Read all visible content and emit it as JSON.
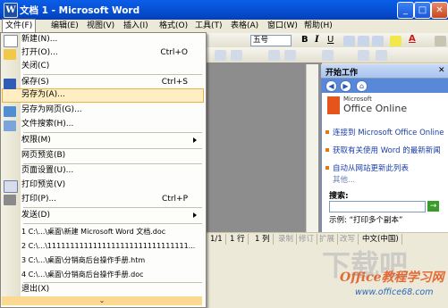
{
  "window": {
    "title": "文档 1 - Microsoft Word",
    "controls": {
      "minimize": "_",
      "maximize": "□",
      "close": "✕"
    },
    "app_icon": "W"
  },
  "menubar": {
    "items": [
      "文件(F)",
      "编辑(E)",
      "视图(V)",
      "插入(I)",
      "格式(O)",
      "工具(T)",
      "表格(A)",
      "窗口(W)",
      "帮助(H)"
    ]
  },
  "toolbar": {
    "font_size": "五号",
    "bold": "B",
    "italic": "I",
    "underline": "U",
    "font_color_letter": "A"
  },
  "file_menu": {
    "items": [
      {
        "label": "新建(N)...",
        "shortcut": "",
        "submenu": false
      },
      {
        "label": "打开(O)...",
        "shortcut": "Ctrl+O",
        "submenu": false
      },
      {
        "label": "关闭(C)",
        "shortcut": "",
        "submenu": false
      },
      {
        "label": "保存(S)",
        "shortcut": "Ctrl+S",
        "submenu": false
      },
      {
        "label": "另存为(A)...",
        "shortcut": "",
        "submenu": false,
        "highlighted": true
      },
      {
        "label": "另存为网页(G)...",
        "shortcut": "",
        "submenu": false
      },
      {
        "label": "文件搜索(H)...",
        "shortcut": "",
        "submenu": false
      },
      {
        "label": "权限(M)",
        "shortcut": "",
        "submenu": true
      },
      {
        "label": "网页预览(B)",
        "shortcut": "",
        "submenu": false
      },
      {
        "label": "页面设置(U)...",
        "shortcut": "",
        "submenu": false
      },
      {
        "label": "打印预览(V)",
        "shortcut": "",
        "submenu": false
      },
      {
        "label": "打印(P)...",
        "shortcut": "Ctrl+P",
        "submenu": false
      },
      {
        "label": "发送(D)",
        "shortcut": "",
        "submenu": true
      },
      {
        "label": "1 C:\\...\\桌面\\新建 Microsoft Word 文档.doc",
        "shortcut": "",
        "submenu": false
      },
      {
        "label": "2 C:\\...\\1111111111111111111111111111111...",
        "shortcut": "",
        "submenu": false
      },
      {
        "label": "3 C:\\...\\桌面\\分销商后台操作手册.htm",
        "shortcut": "",
        "submenu": false
      },
      {
        "label": "4 C:\\...\\桌面\\分销商后台操作手册.doc",
        "shortcut": "",
        "submenu": false
      },
      {
        "label": "退出(X)",
        "shortcut": "",
        "submenu": false
      }
    ],
    "more": "⌄"
  },
  "task_pane": {
    "title": "开始工作",
    "close": "✕",
    "logo_small": "Microsoft",
    "logo_large": "Office Online",
    "links": [
      "连接到 Microsoft Office Online",
      "获取有关使用 Word 的最新新闻",
      "自动从网站更新此列表"
    ],
    "more": "其他...",
    "search_label": "搜索:",
    "search_go": "→",
    "example": "示例: “打印多个副本”"
  },
  "statusbar": {
    "cells": [
      "1 行",
      "1 列",
      "录制",
      "修订",
      "扩展",
      "改写",
      "中文(中国)"
    ],
    "prefix": "1/1"
  },
  "watermark": {
    "main": "Office教程学习网",
    "url": "www.office68.com",
    "big": "下载吧"
  },
  "colors": {
    "title_bar": "#0852d8",
    "menu_highlight": "#ffeec2",
    "pane_header": "#a9c3ee"
  },
  "icons": [
    "new-doc-icon",
    "open-folder-icon",
    "save-disk-icon",
    "save-web-icon",
    "search-icon",
    "print-preview-icon",
    "print-icon"
  ]
}
